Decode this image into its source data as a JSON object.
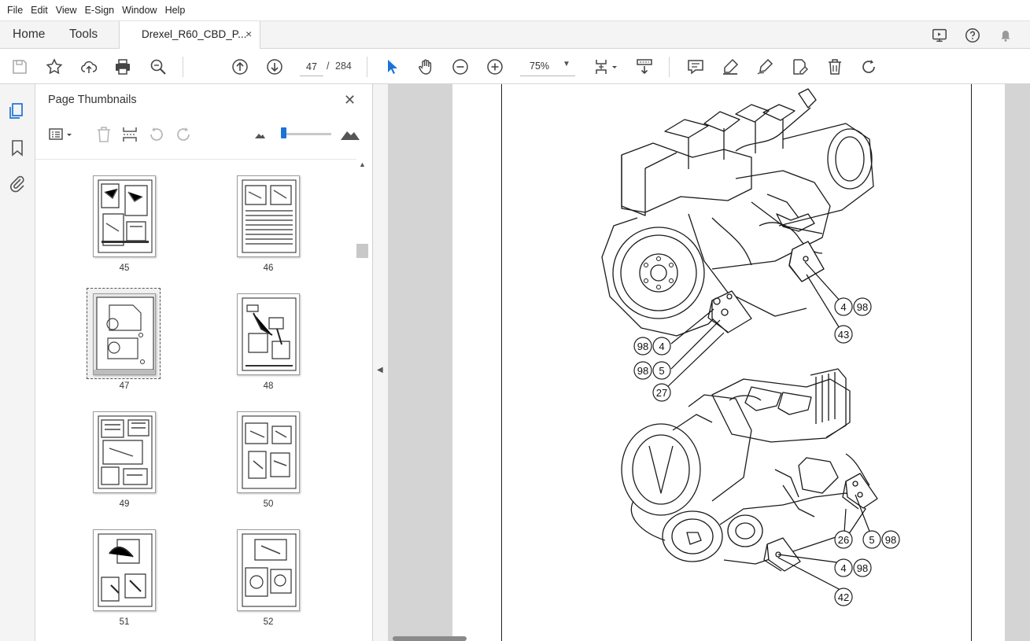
{
  "menu": [
    "File",
    "Edit",
    "View",
    "E-Sign",
    "Window",
    "Help"
  ],
  "tabs": {
    "home": "Home",
    "tools": "Tools",
    "document": "Drexel_R60_CBD_P...",
    "close_glyph": "×"
  },
  "toolbar": {
    "current_page": "47",
    "page_separator": "/",
    "total_pages": "284",
    "zoom": "75%",
    "icons": [
      "save-icon",
      "star-icon",
      "upload-icon",
      "print-icon",
      "zoom-search-icon",
      "page-up-icon",
      "page-down-icon",
      "select-arrow-icon",
      "hand-icon",
      "zoom-out-icon",
      "zoom-in-icon",
      "fit-page-icon",
      "scroll-mode-icon",
      "comment-icon",
      "highlight-icon",
      "sign-icon",
      "edit-icon",
      "delete-icon",
      "rotate-icon"
    ]
  },
  "panel": {
    "title": "Page Thumbnails",
    "close_glyph": "✕",
    "thumbnails": [
      {
        "page": "45",
        "selected": false
      },
      {
        "page": "46",
        "selected": false
      },
      {
        "page": "47",
        "selected": true
      },
      {
        "page": "48",
        "selected": false
      },
      {
        "page": "49",
        "selected": false
      },
      {
        "page": "50",
        "selected": false
      },
      {
        "page": "51",
        "selected": false
      },
      {
        "page": "52",
        "selected": false
      }
    ]
  },
  "diagram": {
    "callouts_top": [
      "4",
      "98",
      "43",
      "98",
      "4",
      "98",
      "5",
      "27"
    ],
    "callouts_bottom": [
      "26",
      "5",
      "98",
      "4",
      "98",
      "42"
    ]
  },
  "colors": {
    "accent": "#1a73d8",
    "panel_bg": "#f4f4f4",
    "doc_bg": "#d4d4d4"
  }
}
